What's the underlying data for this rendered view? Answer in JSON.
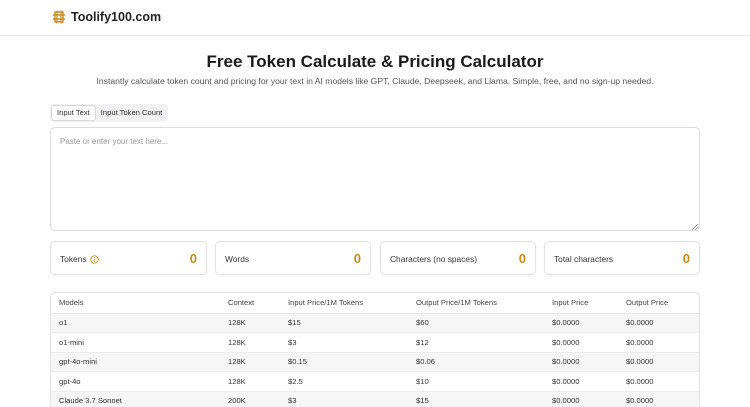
{
  "brand": {
    "name": "Toolify100.com",
    "accent": "#c98a1a"
  },
  "header": {
    "title": "Free Token Calculate & Pricing Calculator",
    "subtitle": "Instantly calculate token count and pricing for your text in AI models like GPT, Claude, Deepseek, and Llama. Simple, free, and no sign-up needed."
  },
  "tabs": [
    {
      "label": "Input Text",
      "active": true
    },
    {
      "label": "Input Token Count",
      "active": false
    }
  ],
  "input": {
    "placeholder": "Paste or enter your text here...",
    "value": ""
  },
  "stats": [
    {
      "label": "Tokens",
      "value": "0",
      "icon": "info-icon"
    },
    {
      "label": "Words",
      "value": "0"
    },
    {
      "label": "Characters (no spaces)",
      "value": "0"
    },
    {
      "label": "Total characters",
      "value": "0"
    }
  ],
  "table": {
    "columns": [
      "Models",
      "Context",
      "Input Price/1M Tokens",
      "Output Price/1M Tokens",
      "Input Price",
      "Output Price"
    ],
    "rows": [
      [
        "o1",
        "128K",
        "$15",
        "$60",
        "$0.0000",
        "$0.0000"
      ],
      [
        "o1-mini",
        "128K",
        "$3",
        "$12",
        "$0.0000",
        "$0.0000"
      ],
      [
        "gpt-4o-mini",
        "128K",
        "$0.15",
        "$0.06",
        "$0.0000",
        "$0.0000"
      ],
      [
        "gpt-4o",
        "128K",
        "$2.5",
        "$10",
        "$0.0000",
        "$0.0000"
      ],
      [
        "Claude 3.7 Sonnet",
        "200K",
        "$3",
        "$15",
        "$0.0000",
        "$0.0000"
      ]
    ]
  }
}
